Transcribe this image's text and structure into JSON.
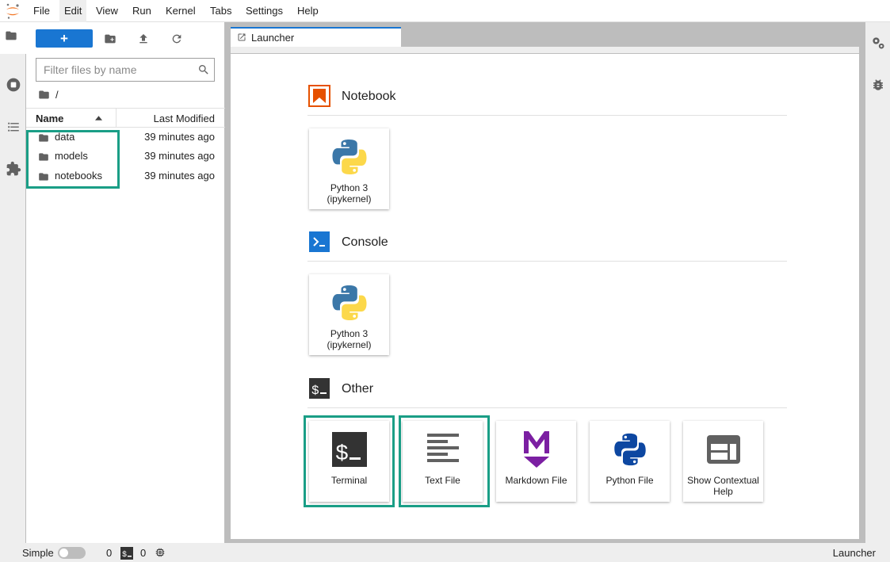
{
  "menubar": {
    "items": [
      "File",
      "Edit",
      "View",
      "Run",
      "Kernel",
      "Tabs",
      "Settings",
      "Help"
    ],
    "active": "Edit"
  },
  "filebrowser": {
    "new_label": "+",
    "search_placeholder": "Filter files by name",
    "breadcrumb": "/",
    "columns": {
      "name": "Name",
      "modified": "Last Modified"
    },
    "files": [
      {
        "name": "data",
        "modified": "39 minutes ago"
      },
      {
        "name": "models",
        "modified": "39 minutes ago"
      },
      {
        "name": "notebooks",
        "modified": "39 minutes ago"
      }
    ]
  },
  "tabs": [
    {
      "label": "Launcher",
      "icon": "launcher-icon"
    }
  ],
  "launcher": {
    "sections": [
      {
        "title": "Notebook",
        "icon": "notebook-icon",
        "cards": [
          {
            "label": "Python 3 (ipykernel)",
            "icon": "python-logo-icon"
          }
        ]
      },
      {
        "title": "Console",
        "icon": "console-icon",
        "cards": [
          {
            "label": "Python 3 (ipykernel)",
            "icon": "python-logo-icon"
          }
        ]
      },
      {
        "title": "Other",
        "icon": "terminal-icon",
        "cards": [
          {
            "label": "Terminal",
            "icon": "terminal-icon"
          },
          {
            "label": "Text File",
            "icon": "text-file-icon"
          },
          {
            "label": "Markdown File",
            "icon": "markdown-icon"
          },
          {
            "label": "Python File",
            "icon": "python-file-icon"
          },
          {
            "label": "Show Contextual Help",
            "icon": "contextual-help-icon"
          }
        ]
      }
    ]
  },
  "statusbar": {
    "mode_label": "Simple",
    "simple_mode_on": false,
    "terminals_count": "0",
    "kernels_count": "0",
    "current_activity": "Launcher"
  },
  "colors": {
    "accent": "#1976d2",
    "highlight": "#1a9e86",
    "notebook_orange": "#e65100",
    "console_blue": "#1976d2",
    "markdown_purple": "#7b1fa2",
    "python_blue": "#0d47a1"
  }
}
